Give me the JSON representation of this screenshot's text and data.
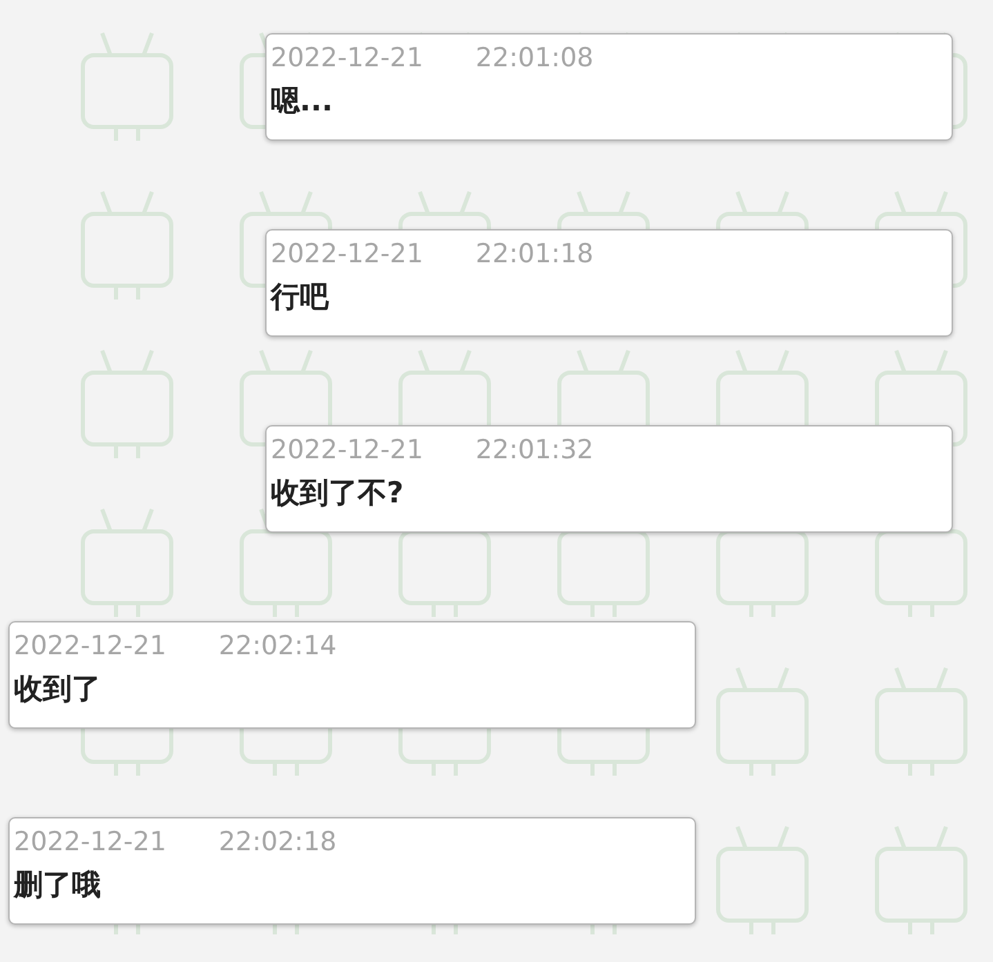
{
  "messages": [
    {
      "kind": "sent",
      "date": "2022-12-21",
      "time": "22:01:08",
      "text": "嗯..."
    },
    {
      "kind": "sent",
      "date": "2022-12-21",
      "time": "22:01:18",
      "text": "行吧"
    },
    {
      "kind": "sent",
      "date": "2022-12-21",
      "time": "22:01:32",
      "text": "收到了不?"
    },
    {
      "kind": "received",
      "date": "2022-12-21",
      "time": "22:02:14",
      "text": "收到了"
    },
    {
      "kind": "received",
      "date": "2022-12-21",
      "time": "22:02:18",
      "text": "删了哦"
    }
  ]
}
